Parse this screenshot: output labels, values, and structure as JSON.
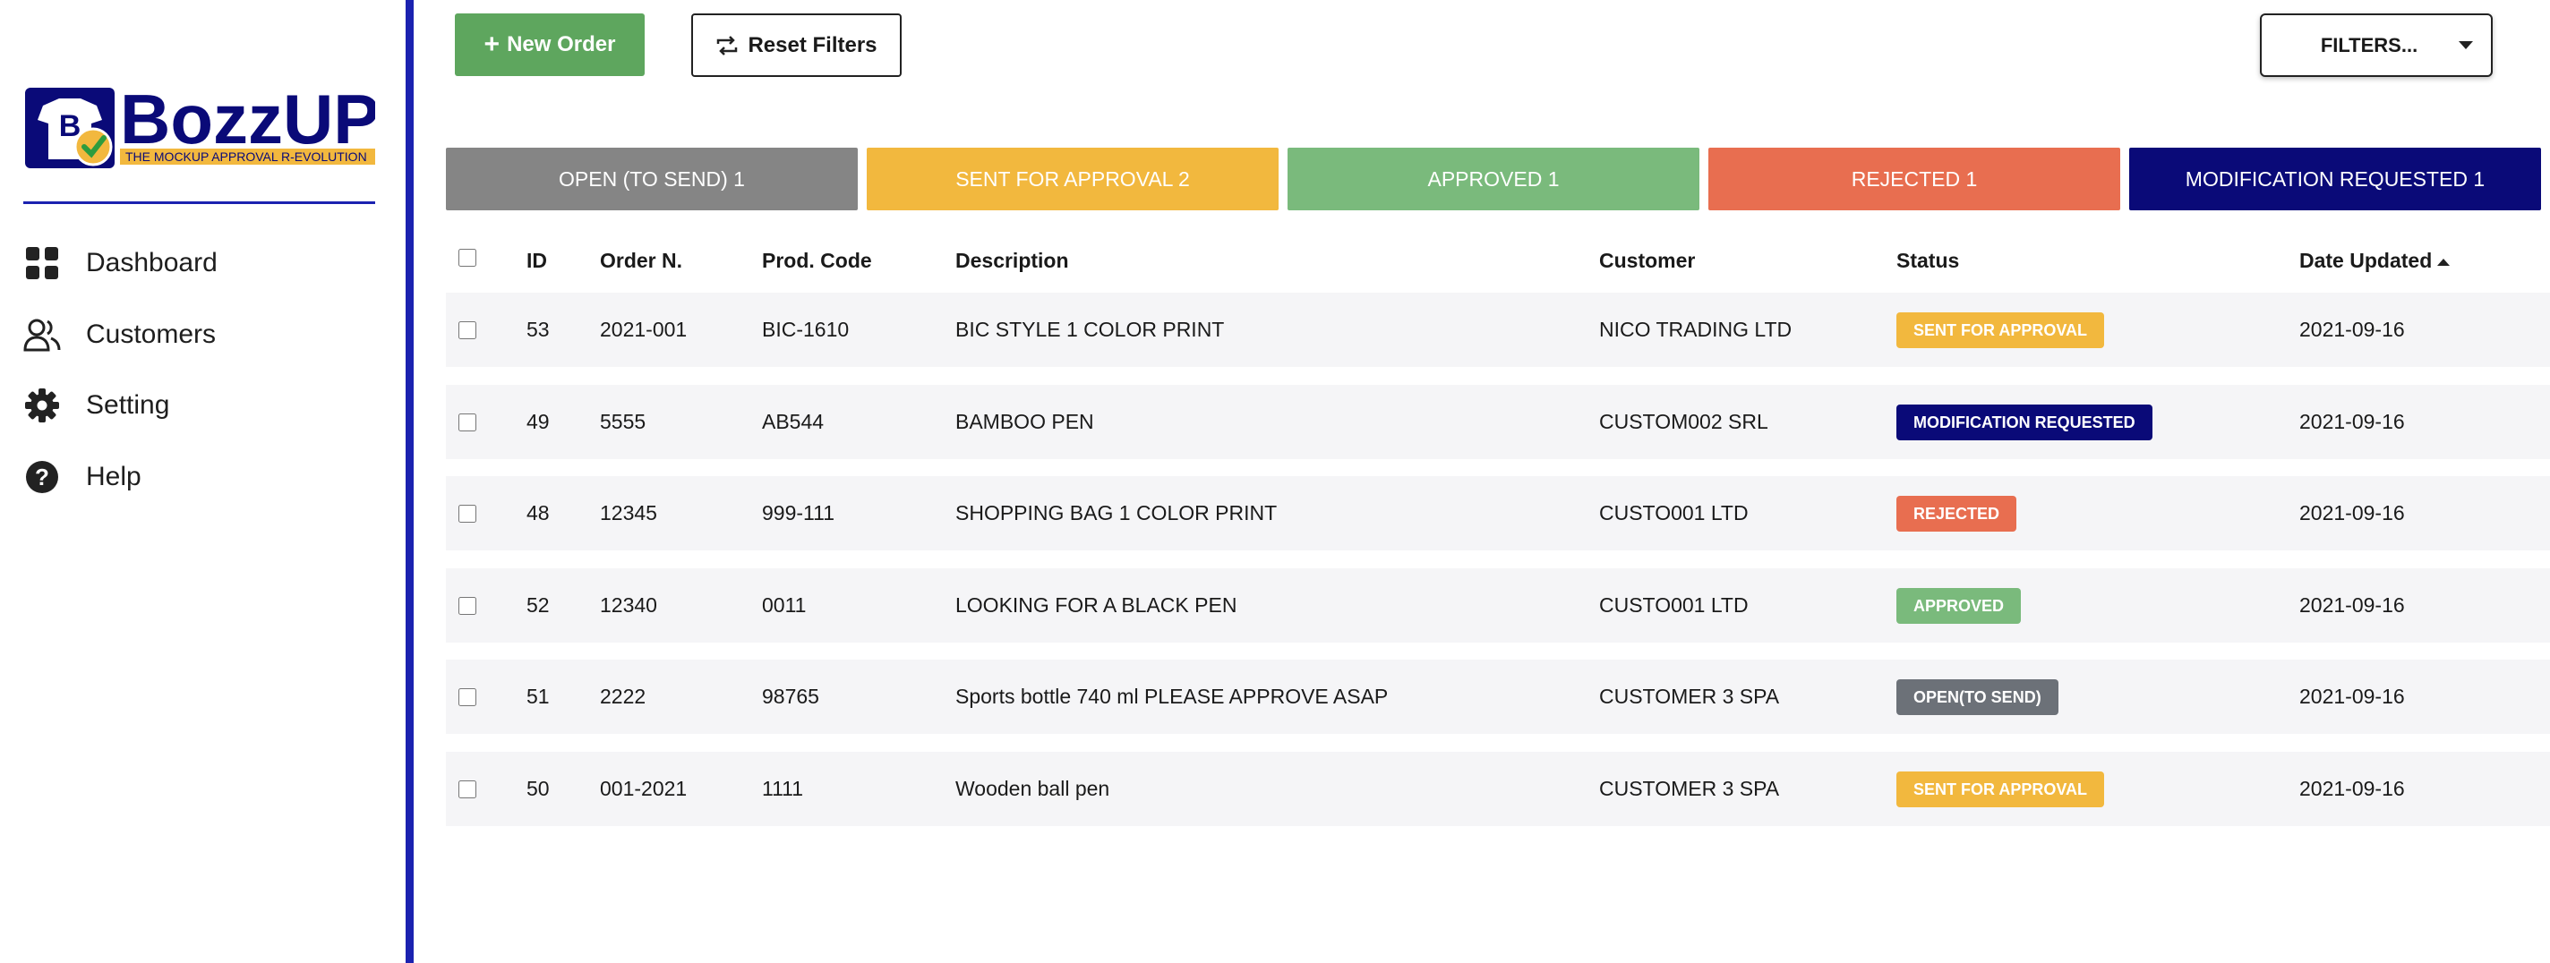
{
  "brand": {
    "name": "BozzUP",
    "tagline": "THE MOCKUP APPROVAL R-EVOLUTION",
    "monogram": "B",
    "primary_color": "#1b22b0",
    "navy_color": "#0a0a78"
  },
  "sidebar": {
    "items": [
      {
        "label": "Dashboard",
        "icon": "dashboard-icon"
      },
      {
        "label": "Customers",
        "icon": "users-icon"
      },
      {
        "label": "Setting",
        "icon": "gear-icon"
      },
      {
        "label": "Help",
        "icon": "help-icon"
      }
    ]
  },
  "toolbar": {
    "new_order": "New Order",
    "reset_filters": "Reset Filters",
    "filters": "FILTERS..."
  },
  "tabs": [
    {
      "label": "OPEN (TO SEND) 1",
      "color": "#858585"
    },
    {
      "label": "SENT FOR APPROVAL 2",
      "color": "#f2b83e"
    },
    {
      "label": "APPROVED 1",
      "color": "#7aba7c"
    },
    {
      "label": "REJECTED 1",
      "color": "#e86e50"
    },
    {
      "label": "MODIFICATION REQUESTED 1",
      "color": "#0a0a78"
    }
  ],
  "table": {
    "columns": {
      "id": "ID",
      "order": "Order N.",
      "prod": "Prod. Code",
      "desc": "Description",
      "customer": "Customer",
      "status": "Status",
      "date": "Date Updated"
    },
    "sort": {
      "column": "date",
      "direction": "ascending"
    },
    "rows": [
      {
        "id": "53",
        "order": "2021-001",
        "prod": "BIC-1610",
        "desc": "BIC STYLE 1 COLOR PRINT",
        "customer": "NICO TRADING LTD",
        "status": "SENT FOR APPROVAL",
        "status_color": "#f2b83e",
        "date": "2021-09-16"
      },
      {
        "id": "49",
        "order": "5555",
        "prod": "AB544",
        "desc": "BAMBOO PEN",
        "customer": "CUSTOM002 SRL",
        "status": "MODIFICATION REQUESTED",
        "status_color": "#0a0a78",
        "date": "2021-09-16"
      },
      {
        "id": "48",
        "order": "12345",
        "prod": "999-111",
        "desc": "SHOPPING BAG 1 COLOR PRINT",
        "customer": "CUSTO001 LTD",
        "status": "REJECTED",
        "status_color": "#e86e50",
        "date": "2021-09-16"
      },
      {
        "id": "52",
        "order": "12340",
        "prod": "0011",
        "desc": "LOOKING FOR A BLACK PEN",
        "customer": "CUSTO001 LTD",
        "status": "APPROVED",
        "status_color": "#7aba7c",
        "date": "2021-09-16"
      },
      {
        "id": "51",
        "order": "2222",
        "prod": "98765",
        "desc": "Sports bottle 740 ml PLEASE APPROVE ASAP",
        "customer": "CUSTOMER 3 SPA",
        "status": "OPEN(TO SEND)",
        "status_color": "#6c7178",
        "date": "2021-09-16"
      },
      {
        "id": "50",
        "order": "001-2021",
        "prod": "1111",
        "desc": "Wooden ball pen",
        "customer": "CUSTOMER 3 SPA",
        "status": "SENT FOR APPROVAL",
        "status_color": "#f2b83e",
        "date": "2021-09-16"
      }
    ]
  }
}
